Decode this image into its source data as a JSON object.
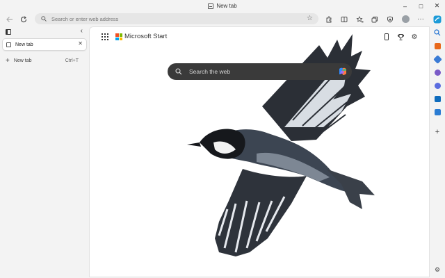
{
  "window": {
    "title": "New tab",
    "controls": {
      "minimize": "–",
      "maximize": "□",
      "close": "✕"
    }
  },
  "toolbar": {
    "back_icon": "arrow-left-icon",
    "refresh_icon": "refresh-icon",
    "address_placeholder": "Search or enter web address",
    "favorite_icon": "star-icon",
    "tools": [
      "extensions-icon",
      "split-screen-icon",
      "favorites-icon",
      "collections-icon",
      "browser-essentials-icon",
      "profile-avatar",
      "more-icon"
    ],
    "more_label": "···"
  },
  "sidepane": {
    "tabs": [
      {
        "label": "New tab",
        "active": true
      }
    ],
    "new_tab_label": "New tab",
    "new_tab_shortcut": "Ctrl+T"
  },
  "content": {
    "brand": "Microsoft Start",
    "search_placeholder": "Search the web",
    "header_icons": [
      "mobile-icon",
      "rewards-trophy-icon",
      "settings-gear-icon"
    ],
    "background_image": "bird-in-flight"
  },
  "rightbar": {
    "items": [
      "copilot-icon",
      "search-icon",
      "shopping-icon",
      "tag-icon",
      "people-icon",
      "office-icon",
      "outlook-icon",
      "word-icon",
      "add-icon",
      "settings-icon"
    ]
  },
  "colors": {
    "accent": "#0078d4",
    "search_bar": "#3a3a3a",
    "page_bg": "#f3f3f3",
    "ms_red": "#f25022",
    "ms_green": "#7fba00",
    "ms_blue": "#00a4ef",
    "ms_yellow": "#ffb900"
  }
}
